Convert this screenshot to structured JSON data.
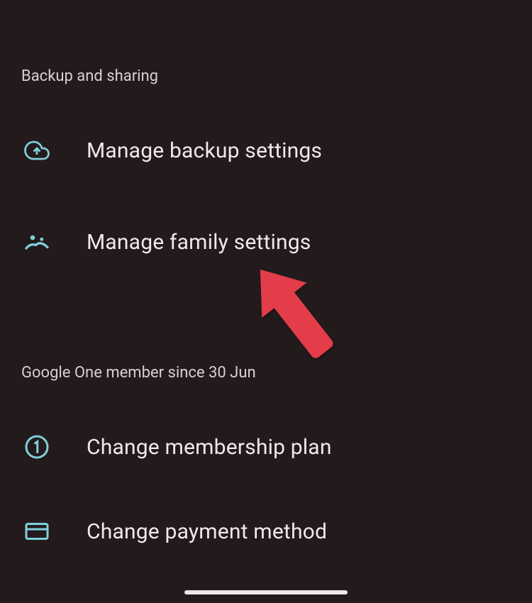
{
  "sections": {
    "backup": {
      "header": "Backup and sharing",
      "items": [
        {
          "label": "Manage backup settings"
        },
        {
          "label": "Manage family settings"
        }
      ]
    },
    "membership": {
      "header": "Google One member since 30 Jun",
      "items": [
        {
          "label": "Change membership plan"
        },
        {
          "label": "Change payment method"
        }
      ]
    }
  },
  "colors": {
    "background": "#231a1c",
    "accent": "#7fd0da",
    "text": "#f0e9ea",
    "annotation": "#e23e49"
  }
}
